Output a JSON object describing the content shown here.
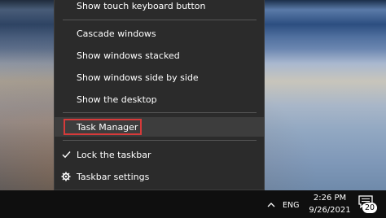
{
  "context_menu": {
    "items": [
      {
        "label": "Show touch keyboard button"
      },
      {
        "label": "Cascade windows"
      },
      {
        "label": "Show windows stacked"
      },
      {
        "label": "Show windows side by side"
      },
      {
        "label": "Show the desktop"
      },
      {
        "label": "Task Manager",
        "highlighted": true
      },
      {
        "label": "Lock the taskbar",
        "checked": true
      },
      {
        "label": "Taskbar settings",
        "icon": "gear-icon"
      }
    ]
  },
  "system_tray": {
    "chevron_icon": "chevron-up-icon",
    "language": "ENG",
    "time": "2:26 PM",
    "date": "9/26/2021",
    "notification_icon": "notification-icon",
    "notification_count": "20"
  },
  "colors": {
    "menu_background": "#2b2b2b",
    "menu_hover": "#3d3d3d",
    "annotation_box": "#d63a3a",
    "taskbar": "#0f0f0f"
  }
}
